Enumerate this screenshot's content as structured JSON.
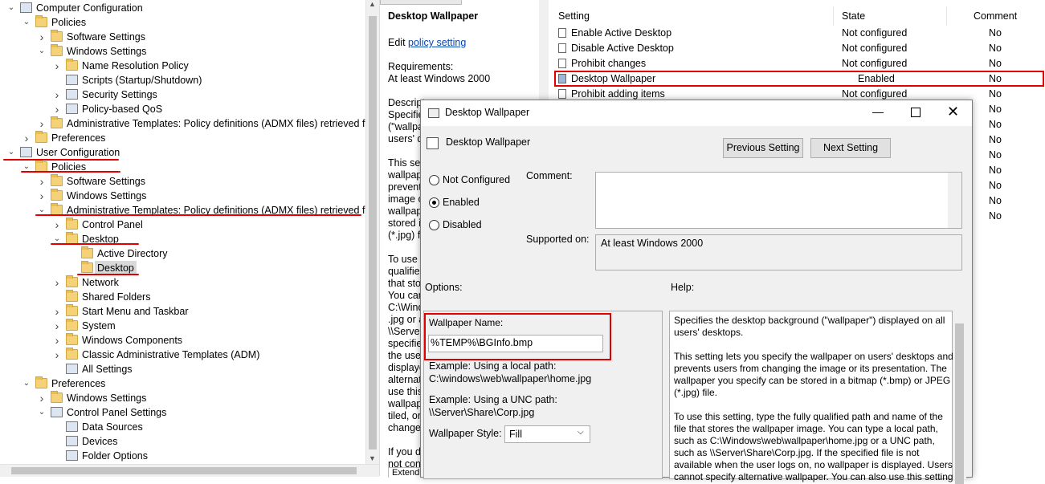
{
  "tree": {
    "items": [
      {
        "label": "Computer Configuration",
        "level": 0,
        "icon": "computer-icon",
        "expanded": true
      },
      {
        "label": "Policies",
        "level": 1,
        "icon": "folder-icon",
        "expanded": true
      },
      {
        "label": "Software Settings",
        "level": 2,
        "icon": "folder-icon",
        "expanded": false
      },
      {
        "label": "Windows Settings",
        "level": 2,
        "icon": "folder-icon",
        "expanded": true
      },
      {
        "label": "Name Resolution Policy",
        "level": 3,
        "icon": "folder-icon",
        "expanded": false
      },
      {
        "label": "Scripts (Startup/Shutdown)",
        "level": 3,
        "icon": "script-icon",
        "expanded": null
      },
      {
        "label": "Security Settings",
        "level": 3,
        "icon": "security-icon",
        "expanded": false
      },
      {
        "label": "Policy-based QoS",
        "level": 3,
        "icon": "chart-icon",
        "expanded": false
      },
      {
        "label": "Administrative Templates: Policy definitions (ADMX files) retrieved from",
        "level": 2,
        "icon": "folder-icon",
        "expanded": false
      },
      {
        "label": "Preferences",
        "level": 1,
        "icon": "folder-icon",
        "expanded": false
      },
      {
        "label": "User Configuration",
        "level": 0,
        "icon": "user-icon",
        "expanded": true
      },
      {
        "label": "Policies",
        "level": 1,
        "icon": "folder-icon",
        "expanded": true
      },
      {
        "label": "Software Settings",
        "level": 2,
        "icon": "folder-icon",
        "expanded": false
      },
      {
        "label": "Windows Settings",
        "level": 2,
        "icon": "folder-icon",
        "expanded": false
      },
      {
        "label": "Administrative Templates: Policy definitions (ADMX files) retrieved from",
        "level": 2,
        "icon": "folder-icon",
        "expanded": true
      },
      {
        "label": "Control Panel",
        "level": 3,
        "icon": "folder-icon",
        "expanded": false
      },
      {
        "label": "Desktop",
        "level": 3,
        "icon": "folder-icon",
        "expanded": true
      },
      {
        "label": "Active Directory",
        "level": 4,
        "icon": "folder-icon",
        "expanded": null
      },
      {
        "label": "Desktop",
        "level": 4,
        "icon": "folder-icon",
        "expanded": null,
        "selected": true
      },
      {
        "label": "Network",
        "level": 3,
        "icon": "folder-icon",
        "expanded": false
      },
      {
        "label": "Shared Folders",
        "level": 3,
        "icon": "folder-icon",
        "expanded": null
      },
      {
        "label": "Start Menu and Taskbar",
        "level": 3,
        "icon": "folder-icon",
        "expanded": false
      },
      {
        "label": "System",
        "level": 3,
        "icon": "folder-icon",
        "expanded": false
      },
      {
        "label": "Windows Components",
        "level": 3,
        "icon": "folder-icon",
        "expanded": false
      },
      {
        "label": "Classic Administrative Templates (ADM)",
        "level": 3,
        "icon": "folder-icon",
        "expanded": false
      },
      {
        "label": "All Settings",
        "level": 3,
        "icon": "settings-list-icon",
        "expanded": null
      },
      {
        "label": "Preferences",
        "level": 1,
        "icon": "folder-icon",
        "expanded": true
      },
      {
        "label": "Windows Settings",
        "level": 2,
        "icon": "folder-icon",
        "expanded": false
      },
      {
        "label": "Control Panel Settings",
        "level": 2,
        "icon": "control-panel-icon",
        "expanded": true
      },
      {
        "label": "Data Sources",
        "level": 3,
        "icon": "data-sources-icon",
        "expanded": null
      },
      {
        "label": "Devices",
        "level": 3,
        "icon": "devices-icon",
        "expanded": null
      },
      {
        "label": "Folder Options",
        "level": 3,
        "icon": "folder-options-icon",
        "expanded": null
      }
    ]
  },
  "extended": {
    "title": "Desktop Wallpaper",
    "edit_prefix": "Edit ",
    "edit_link": "policy setting",
    "requirements_label": "Requirements:",
    "requirements_value": "At least Windows 2000",
    "desc_lines": [
      "Descript",
      "Specifie",
      "(\"wallpa",
      "users' d"
    ],
    "body_lines_1": [
      "This set",
      "wallpap",
      "prevents",
      "image o",
      "wallpap",
      "stored in",
      "(*.jpg) fi"
    ],
    "body_lines_2": [
      "To use t",
      "qualified",
      "that sto",
      "You can",
      "C:\\Wind",
      ".jpg or a",
      "\\\\Server",
      "specifie",
      "the user",
      "displaye",
      "alternati",
      "use this",
      "wallpap",
      "tiled, or",
      "change"
    ],
    "body_lines_3": [
      "If you di",
      "not con"
    ],
    "tab": "Extend"
  },
  "list": {
    "headers": {
      "setting": "Setting",
      "state": "State",
      "comment": "Comment"
    },
    "rows": [
      {
        "setting": "Enable Active Desktop",
        "state": "Not configured",
        "comment": "No"
      },
      {
        "setting": "Disable Active Desktop",
        "state": "Not configured",
        "comment": "No"
      },
      {
        "setting": "Prohibit changes",
        "state": "Not configured",
        "comment": "No"
      },
      {
        "setting": "Desktop Wallpaper",
        "state": "Enabled",
        "comment": "No",
        "highlight": true
      },
      {
        "setting": "Prohibit adding items",
        "state": "Not configured",
        "comment": "No"
      },
      {
        "setting": "",
        "state": "",
        "comment": "No"
      },
      {
        "setting": "",
        "state": "",
        "comment": "No"
      },
      {
        "setting": "",
        "state": "",
        "comment": "No"
      },
      {
        "setting": "",
        "state": "",
        "comment": "No"
      },
      {
        "setting": "",
        "state": "",
        "comment": "No"
      },
      {
        "setting": "",
        "state": "",
        "comment": "No"
      },
      {
        "setting": "",
        "state": "",
        "comment": "No"
      },
      {
        "setting": "",
        "state": "",
        "comment": "No"
      }
    ]
  },
  "dialog": {
    "window_title": "Desktop Wallpaper",
    "heading": "Desktop Wallpaper",
    "prev_btn": "Previous Setting",
    "next_btn": "Next Setting",
    "radio_not_configured": "Not Configured",
    "radio_enabled": "Enabled",
    "radio_disabled": "Disabled",
    "selected_radio": "Enabled",
    "comment_label": "Comment:",
    "comment_value": "",
    "supported_label": "Supported on:",
    "supported_value": "At least Windows 2000",
    "options_label": "Options:",
    "help_label": "Help:",
    "wallpaper_name_label": "Wallpaper Name:",
    "wallpaper_name_value": "%TEMP%\\BGInfo.bmp",
    "example_local_1": "Example: Using a local path:",
    "example_local_2": "C:\\windows\\web\\wallpaper\\home.jpg",
    "example_unc_1": "Example: Using a UNC path:",
    "example_unc_2": "\\\\Server\\Share\\Corp.jpg",
    "style_label": "Wallpaper Style:",
    "style_value": "Fill",
    "help_lines": [
      "Specifies the desktop background (\"wallpaper\") displayed on all",
      "users' desktops.",
      "",
      "This setting lets you specify the wallpaper on users' desktops and",
      "prevents users from changing the image or its presentation. The",
      "wallpaper you specify can be stored in a bitmap (*.bmp) or JPEG",
      "(*.jpg) file.",
      "",
      "To use this setting, type the fully qualified path and name of the",
      "file that stores the wallpaper image. You can type a local path,",
      "such as C:\\Windows\\web\\wallpaper\\home.jpg or a UNC path,",
      "such as \\\\Server\\Share\\Corp.jpg. If the specified file is not",
      "available when the user logs on, no wallpaper is displayed. Users",
      "cannot specify alternative wallpaper. You can also use this setting"
    ]
  },
  "colors": {
    "annotation_red": "#e00000",
    "link": "#0645ad",
    "selection": "#d9d9d9"
  }
}
